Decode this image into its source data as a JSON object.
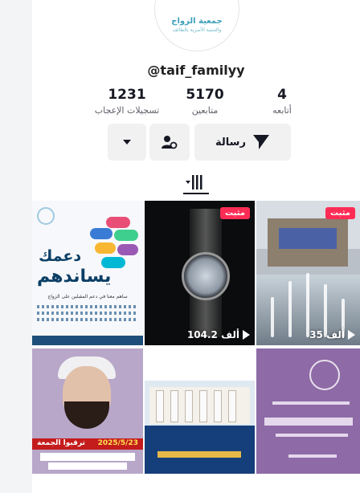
{
  "profile": {
    "username": "@taif_familyy",
    "logo_line1": "جمعية الزواج",
    "logo_line2": "والتنمية الأسرية بالطائف"
  },
  "stats": {
    "following": {
      "value": "4",
      "label": "أتابعه"
    },
    "followers": {
      "value": "5170",
      "label": "متابعين"
    },
    "likes": {
      "value": "1231",
      "label": "تسجيلات الإعجاب"
    }
  },
  "actions": {
    "message_label": "رسالة"
  },
  "videos": [
    {
      "pinned_label": "",
      "views": "",
      "title1": "دعمك",
      "title2": "يساندهم",
      "subtitle": "ساهم معنا في دعم المقبلين على الزواج"
    },
    {
      "pinned_label": "مثبت",
      "views": "104.2 ألف"
    },
    {
      "pinned_label": "مثبت",
      "views": "35 ألف"
    },
    {
      "pinned_label": "",
      "views": "",
      "banner_text": "ترقبوا الجمعة",
      "date": "2025/5/23"
    },
    {
      "pinned_label": "",
      "views": ""
    },
    {
      "pinned_label": "",
      "views": ""
    }
  ],
  "colors": {
    "pinned_badge": "#fe2c55",
    "button_bg": "#f1f1f2",
    "text_primary": "#161823"
  }
}
